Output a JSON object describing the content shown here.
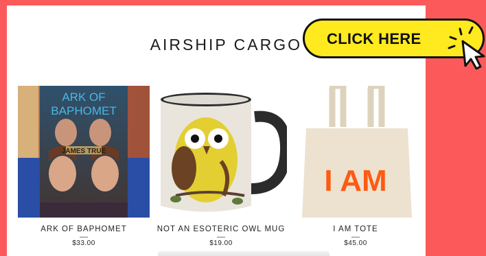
{
  "store": {
    "title": "AIRSHIP CARGO"
  },
  "cta": {
    "label": "CLICK HERE"
  },
  "products": [
    {
      "name": "ARK OF BAPHOMET",
      "price": "$33.00",
      "cover_title": "ARK OF BAPHOMET",
      "cover_author": "JAMES TRUE"
    },
    {
      "name": "NOT AN ESOTERIC OWL MUG",
      "price": "$19.00"
    },
    {
      "name": "I AM TOTE",
      "price": "$45.00",
      "tote_text": "I AM"
    }
  ],
  "colors": {
    "background": "#fc5a5a",
    "cta": "#ffea1f",
    "tote_text": "#ff5a14"
  },
  "icons": [
    "cursor-icon",
    "sparkle-icon"
  ]
}
